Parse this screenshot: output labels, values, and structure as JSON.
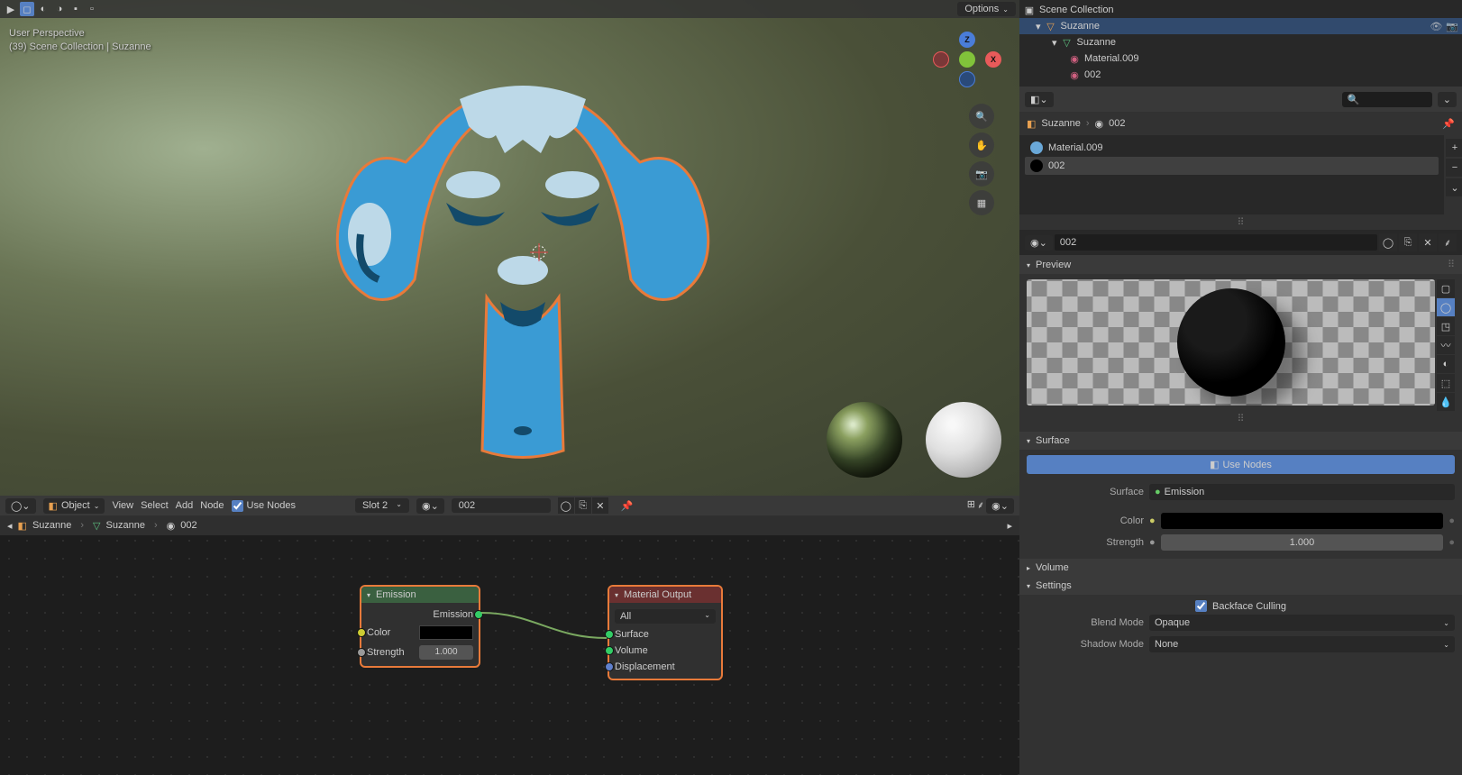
{
  "viewport": {
    "options_label": "Options",
    "info_line1": "User Perspective",
    "info_line2": "(39) Scene Collection | Suzanne",
    "axes": {
      "x": "X",
      "y": "",
      "z": "Z"
    }
  },
  "outliner": {
    "scene_collection": "Scene Collection",
    "items": [
      {
        "name": "Suzanne",
        "type": "mesh"
      },
      {
        "name": "Suzanne",
        "type": "mesh-child"
      },
      {
        "name": "Material.009",
        "type": "material"
      },
      {
        "name": "002",
        "type": "material"
      }
    ]
  },
  "node_editor": {
    "mode": "Object",
    "menus": [
      "View",
      "Select",
      "Add",
      "Node"
    ],
    "use_nodes": "Use Nodes",
    "slot": "Slot 2",
    "material": "002",
    "breadcrumb": [
      "Suzanne",
      "Suzanne",
      "002"
    ]
  },
  "nodes": {
    "emission": {
      "title": "Emission",
      "out_socket": "Emission",
      "color_label": "Color",
      "strength_label": "Strength",
      "strength_value": "1.000"
    },
    "material_output": {
      "title": "Material Output",
      "target": "All",
      "surface": "Surface",
      "volume": "Volume",
      "displacement": "Displacement"
    }
  },
  "properties": {
    "breadcrumb_obj": "Suzanne",
    "breadcrumb_mat": "002",
    "mat_slots": [
      "Material.009",
      "002"
    ],
    "mat_name": "002",
    "panels": {
      "preview": "Preview",
      "surface": "Surface",
      "volume": "Volume",
      "settings": "Settings"
    },
    "use_nodes_btn": "Use Nodes",
    "surface_label": "Surface",
    "surface_value": "Emission",
    "color_label": "Color",
    "strength_label": "Strength",
    "strength_value": "1.000",
    "backface": "Backface Culling",
    "blend_mode_label": "Blend Mode",
    "blend_mode_value": "Opaque",
    "shadow_mode_label": "Shadow Mode",
    "shadow_mode_value": "None"
  }
}
